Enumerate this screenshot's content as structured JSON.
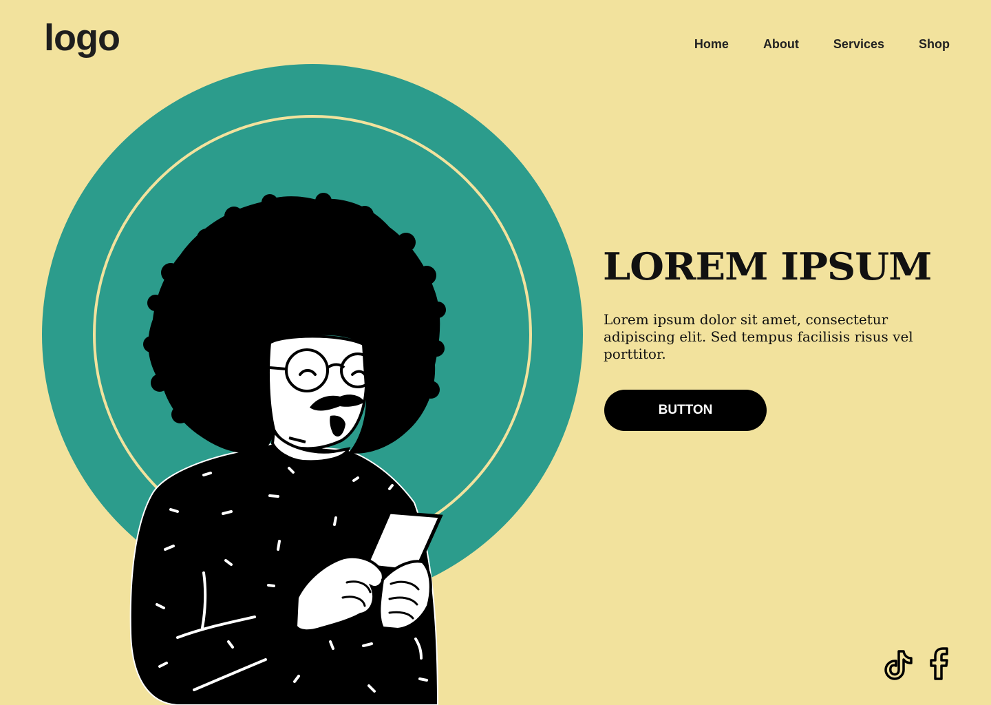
{
  "header": {
    "logo": "logo",
    "nav": [
      "Home",
      "About",
      "Services",
      "Shop"
    ]
  },
  "hero": {
    "title": "LOREM IPSUM",
    "description": "Lorem ipsum dolor sit amet, consectetur adipiscing elit. Sed tempus facilisis risus vel porttitor.",
    "button_label": "BUTTON",
    "illustration": "person-with-afro-looking-at-phone"
  },
  "social": [
    "tiktok-icon",
    "facebook-icon"
  ],
  "colors": {
    "background": "#f2e29d",
    "accent": "#2c9c8c",
    "ink": "#000000"
  }
}
